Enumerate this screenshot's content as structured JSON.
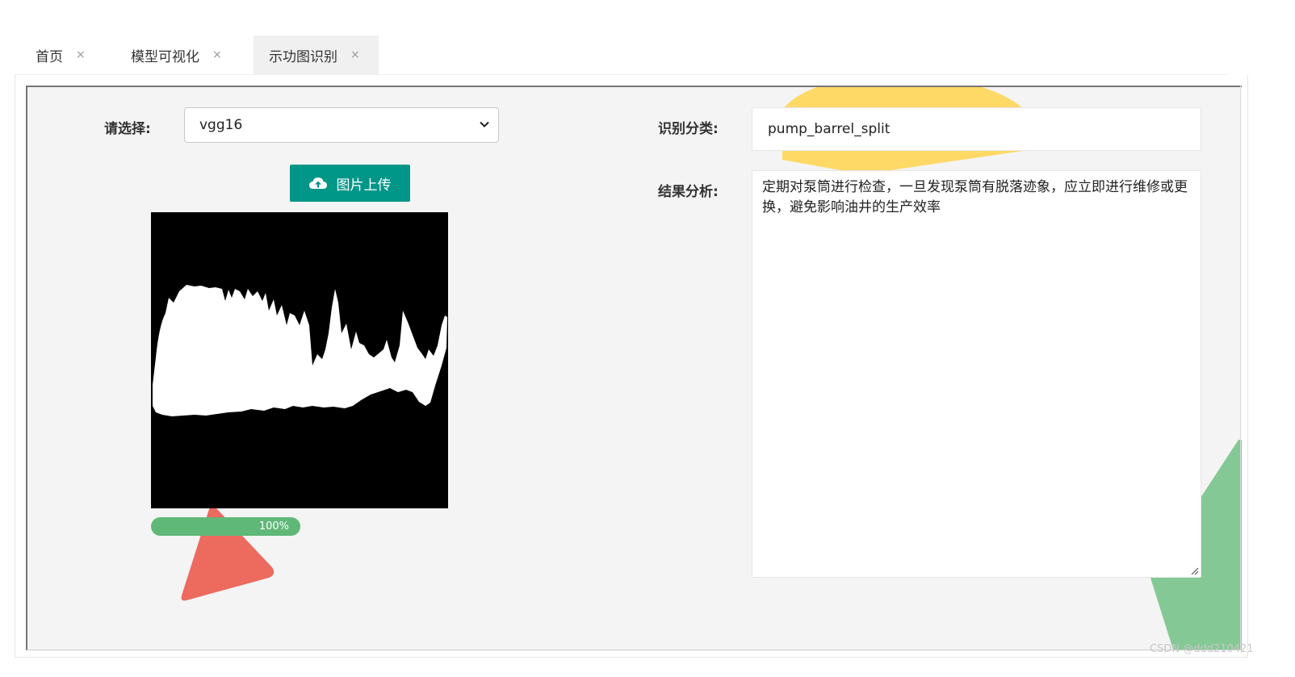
{
  "tabs": [
    {
      "label": "首页",
      "close": "×"
    },
    {
      "label": "模型可视化",
      "close": "×"
    },
    {
      "label": "示功图识别",
      "close": "×",
      "active": true
    }
  ],
  "form": {
    "select_label": "请选择:",
    "select_value": "vgg16",
    "upload_label": "图片上传",
    "progress_text": "100%",
    "progress_value": 1.0,
    "result_label": "识别分类:",
    "result_value": "pump_barrel_split",
    "analysis_label": "结果分析:",
    "analysis_text": "定期对泵筒进行检查，一旦发现泵筒有脱落迹象，应立即进行维修或更换，避免影响油井的生产效率"
  },
  "colors": {
    "accent": "#009688",
    "progress": "#5fb878",
    "deco_yellow": "#ffd966",
    "deco_green": "#84c995",
    "deco_red": "#ec6a5e"
  },
  "icons": {
    "upload": "cloud-upload-icon",
    "dropdown": "chevron-down-icon",
    "close": "close-icon"
  },
  "watermark": "CSDN @ddd210421"
}
